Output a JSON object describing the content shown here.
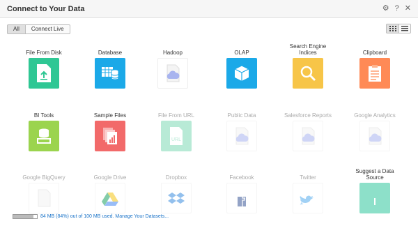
{
  "window": {
    "title": "Connect to Your Data"
  },
  "filters": [
    "All",
    "Connect Live"
  ],
  "footer": {
    "usage_fraction": 0.84,
    "usage_text": "84 MB (84%) out of 100 MB used. Manage Your Datasets..."
  },
  "tiles": [
    {
      "label": "File From Disk",
      "icon": "upload-icon",
      "color": "#2fc794"
    },
    {
      "label": "Database",
      "icon": "database-icon",
      "color": "#1ba9e8"
    },
    {
      "label": "Hadoop",
      "icon": "cloud-file-icon",
      "color": "#ffffff"
    },
    {
      "label": "OLAP",
      "icon": "cube-icon",
      "color": "#1ba9e8"
    },
    {
      "label": "Search Engine\nIndices",
      "icon": "magnifier-icon",
      "color": "#f7c548"
    },
    {
      "label": "Clipboard",
      "icon": "clipboard-icon",
      "color": "#ff8a56"
    },
    {
      "label": "BI Tools",
      "icon": "bi-tools-icon",
      "color": "#9bd44e"
    },
    {
      "label": "Sample Files",
      "icon": "sample-files-icon",
      "color": "#f26a6a"
    },
    {
      "label": "File From URL",
      "icon": "url-file-icon",
      "color": "#7fd9b6"
    },
    {
      "label": "Public Data",
      "icon": "cloud-file-icon",
      "color": "#ffffff"
    },
    {
      "label": "Salesforce Reports",
      "icon": "cloud-file-icon",
      "color": "#ffffff"
    },
    {
      "label": "Google Analytics",
      "icon": "cloud-file-icon",
      "color": "#ffffff"
    },
    {
      "label": "Google BigQuery",
      "icon": "cloud-file-icon",
      "color": "#ffffff"
    },
    {
      "label": "Google Drive",
      "icon": "google-drive-icon",
      "color": "#ffffff"
    },
    {
      "label": "Dropbox",
      "icon": "dropbox-icon",
      "color": "#ffffff"
    },
    {
      "label": "Facebook",
      "icon": "facebook-icon",
      "color": "#ffffff"
    },
    {
      "label": "Twitter",
      "icon": "twitter-icon",
      "color": "#ffffff"
    },
    {
      "label": "Suggest a Data\nSource",
      "icon": "suggest-icon",
      "color": "#8de0c9"
    }
  ]
}
